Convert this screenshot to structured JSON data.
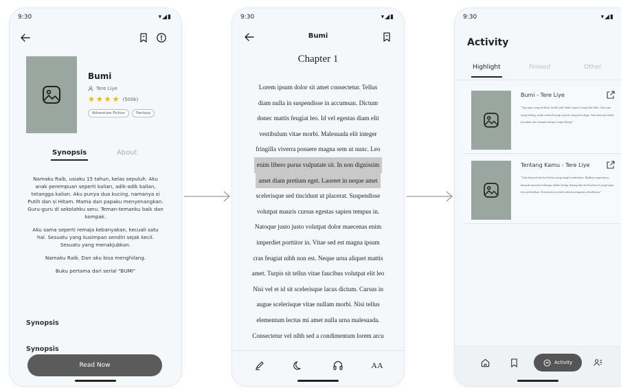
{
  "status": {
    "time": "9:30",
    "icons": "▾◢▮"
  },
  "detail": {
    "book_title": "Bumi",
    "author": "Tere Liye",
    "rating_count": "(500k)",
    "tags": [
      "Adventure Fiction",
      "Fantasy"
    ],
    "tabs": {
      "synopsis": "Synopsis",
      "about": "About"
    },
    "synopsis_paragraphs": [
      "Namaku Raib, usiaku 15 tahun, kelas sepuluh. Aku anak perempuan seperti kalian, adik-adik kalian, tetangga kalian. Aku punya dua kucing, namanya si Putih dan si Hitam. Mama dan papaku menyenangkan. Guru-guru di sekolahku seru. Teman-temanku baik dan kompak.",
      "Aku sama seperti remaja kebanyakan, kecuali satu hal. Sesuatu yang kusimpan sendiri sejak kecil. Sesuatu yang menakjubkan.",
      "Namaku Raib. Dan aku bisa menghilang.",
      "Buku pertama dari serial \"BUMI\""
    ],
    "section_heads": [
      "Synopsis",
      "Synopsis"
    ],
    "read_now": "Read Now"
  },
  "reader": {
    "title": "Bumi",
    "chapter": "Chapter 1",
    "lines": [
      "Lorem ipsum dolor sit amet consectetur. Tellus",
      "diam nulla in suspendisse in accumsan. Dictum",
      "donec mattis feugiat leo. Id vel egestas diam elit",
      "vestibulum vitae morbi. Malesuada elit integer",
      "fringilla viverra posuere magna sem ut nunc. Leo",
      "enim libero purus vulputate sit. In non dignissim",
      "amet diam pretium eget. Laoreet in neque amet",
      "scelerisque sed tincidunt ut placerat. Suspendisse",
      "volutpat mauris cursus egestas sapien tempus in.",
      "Natoque justo justo volutpat dolor maecenas enim",
      "imperdiet porttitor in. Vitae sed est magna ipsum",
      "cras feugiat nibh non est. Neque urna aliquet mattis",
      "amet. Turpis sit tellus vitae faucibus volutpat elit leo",
      "Nisi vel et id sit scelerisque lacus dictum. Cursus in",
      "augue scelerisque vitae nullam morbi. Nisi tellus",
      "elementum lectus mi amet nulla urna malesuada.",
      "Consectetur vel nibh sed a condimentum lorem arcu"
    ],
    "highlighted_lines": [
      5,
      6
    ],
    "font_size_label": "AA"
  },
  "activity": {
    "title": "Activity",
    "tabs": [
      "Highlight",
      "Finised",
      "Other"
    ],
    "cards": [
      {
        "title": "Bumi - Tere Liye",
        "quote": "\"Apa pun yang terlihat, boleh jadi tidak seperti yang kita lihat. Apa pun yang hilang, tidak selalu lenyap seperti yang kita duga. Ada banyak sekali jawaban dari tempat-tempat yang hilang.\""
      },
      {
        "title": "Tentang Kamu - Tere Liye",
        "quote": "\"Ada banyak hal-hal hebat yang tampil sederhana. Bahkan sepertinya, banyak momen berharga dalam hidup datang dari hal-hal kecil yang luput kita perhatikan. Karena kita terlalu sibuk mengurus sebaliknya.\""
      }
    ],
    "nav_active_label": "Activity"
  }
}
